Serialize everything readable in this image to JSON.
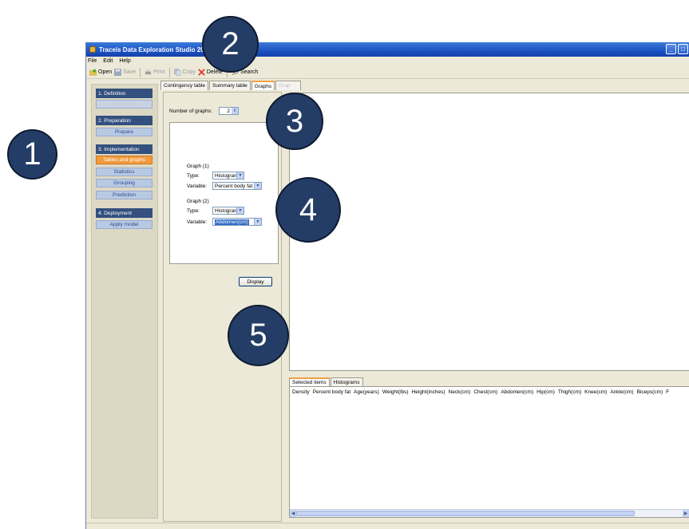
{
  "window": {
    "title": "Traceis Data Exploration Studio 200",
    "buttons": [
      "_",
      "□",
      "×"
    ]
  },
  "menu": [
    "File",
    "Edit",
    "Help"
  ],
  "toolbar": {
    "open": "Open",
    "save": "Save",
    "print": "Print",
    "copy": "Copy",
    "delete": "Delete",
    "search": "Search"
  },
  "sidebar": {
    "sections": [
      {
        "header": "1. Definition",
        "items": [
          "Define"
        ]
      },
      {
        "header": "2. Preparation",
        "items": [
          "Prepare"
        ]
      },
      {
        "header": "3. Implementation",
        "items": [
          "Tables and graphs",
          "Statistics",
          "Grouping",
          "Prediction"
        ]
      },
      {
        "header": "4. Deployment",
        "items": [
          "Apply model"
        ]
      }
    ]
  },
  "tabs": [
    "Contingency table",
    "Summary table",
    "Graphs",
    "Grap"
  ],
  "graphs_panel": {
    "number_label": "Number of graphs:",
    "number_value": "2",
    "graph1": {
      "title": "Graph (1)",
      "type_label": "Type:",
      "type_value": "Histogram",
      "variable_label": "Variable:",
      "variable_value": "Percent body fat"
    },
    "graph2": {
      "title": "Graph (2)",
      "type_label": "Type:",
      "type_value": "Histogram",
      "variable_label": "Variable:",
      "variable_value": "Abdomen(cm)"
    },
    "display_button": "Display"
  },
  "bottom_tabs": [
    "Selected items",
    "Histograms"
  ],
  "columns": [
    "Density",
    "Percent body fat",
    "Age(years)",
    "Weight(lbs)",
    "Height(inches)",
    "Neck(cm)",
    "Chest(cm)",
    "Abdomen(cm)",
    "Hip(cm)",
    "Thigh(cm)",
    "Knee(cm)",
    "Ankle(cm)",
    "Biceps(cm)",
    "F"
  ],
  "callouts": [
    "1",
    "2",
    "3",
    "4",
    "5"
  ]
}
